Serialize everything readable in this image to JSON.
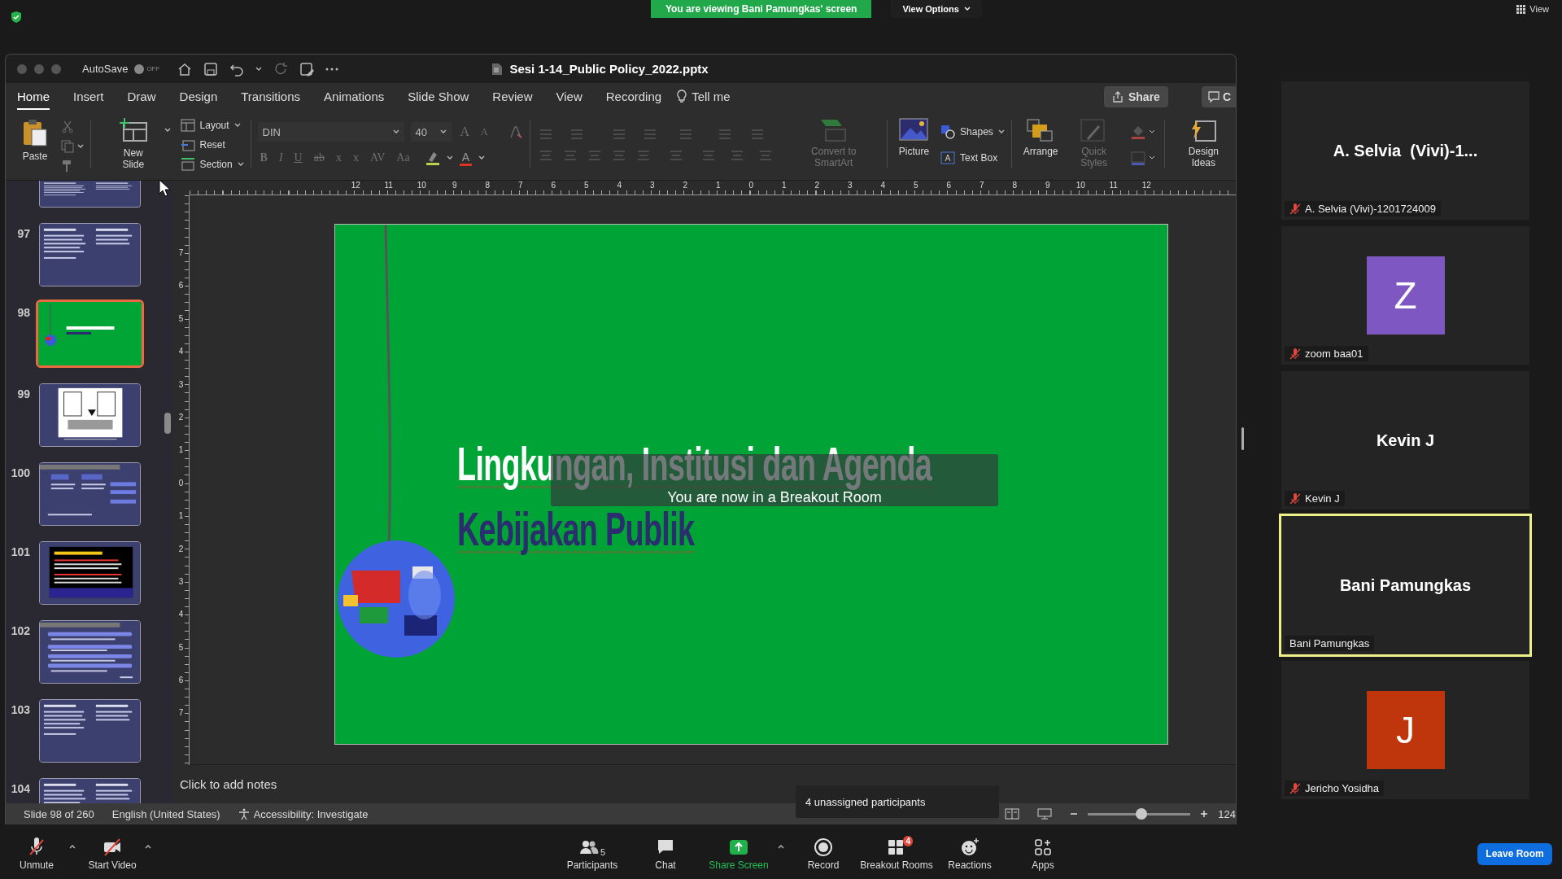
{
  "zoom_top": {
    "banner": "You are viewing Bani Pamungkas' screen",
    "view_options": "View Options",
    "view": "View"
  },
  "ppt": {
    "autosave": {
      "label": "AutoSave",
      "on": false,
      "state": "OFF"
    },
    "title": "Sesi 1-14_Public Policy_2022.pptx",
    "tabs": [
      {
        "label": "Home",
        "selected": true
      },
      {
        "label": "Insert",
        "selected": false
      },
      {
        "label": "Draw",
        "selected": false
      },
      {
        "label": "Design",
        "selected": false
      },
      {
        "label": "Transitions",
        "selected": false
      },
      {
        "label": "Animations",
        "selected": false
      },
      {
        "label": "Slide Show",
        "selected": false
      },
      {
        "label": "Review",
        "selected": false
      },
      {
        "label": "View",
        "selected": false
      },
      {
        "label": "Recording",
        "selected": false
      }
    ],
    "tell_me": "Tell me",
    "share": "Share",
    "comments": "C",
    "ribbon": {
      "paste": {
        "label": "Paste",
        "disabled": false
      },
      "new_slide": {
        "label": "New Slide",
        "disabled": false
      },
      "layout": {
        "label": "Layout",
        "disabled": false
      },
      "reset": {
        "label": "Reset",
        "disabled": false
      },
      "section": {
        "label": "Section",
        "disabled": false
      },
      "font": "DIN",
      "font_size": "40",
      "grow": "A",
      "shrink": "A",
      "format": [
        "B",
        "I",
        "U",
        "ab",
        "x",
        "x",
        "AV",
        "Aa"
      ],
      "font_color": "A",
      "convert": {
        "label": "Convert to SmartArt",
        "disabled": true
      },
      "picture": {
        "label": "Picture",
        "disabled": false
      },
      "shapes": {
        "label": "Shapes",
        "disabled": false
      },
      "text_box": {
        "label": "Text Box",
        "disabled": false
      },
      "arrange": {
        "label": "Arrange",
        "disabled": false
      },
      "quick_styles": {
        "label": "Quick Styles",
        "disabled": true
      },
      "design_ideas": {
        "label": "Design Ideas",
        "disabled": false
      }
    }
  },
  "thumbnails": [
    {
      "kind": "text",
      "partial": true,
      "selected": false
    },
    {
      "number": "97",
      "kind": "text",
      "selected": false
    },
    {
      "number": "98",
      "kind": "title",
      "selected": true
    },
    {
      "number": "99",
      "kind": "cartoon",
      "selected": false
    },
    {
      "number": "100",
      "kind": "diagram",
      "selected": false
    },
    {
      "number": "101",
      "kind": "dark",
      "selected": false
    },
    {
      "number": "102",
      "kind": "list",
      "selected": false
    },
    {
      "number": "103",
      "kind": "text",
      "selected": false
    },
    {
      "number": "104",
      "kind": "text",
      "selected": false
    }
  ],
  "rulers": {
    "horizontal": [
      "12",
      "11",
      "10",
      "9",
      "8",
      "7",
      "6",
      "5",
      "4",
      "3",
      "2",
      "1",
      "0",
      "1",
      "2",
      "3",
      "4",
      "5",
      "6",
      "7",
      "8",
      "9",
      "10",
      "11",
      "12"
    ],
    "vertical": [
      "7",
      "6",
      "5",
      "4",
      "3",
      "2",
      "1",
      "0",
      "1",
      "2",
      "3",
      "4",
      "5",
      "6",
      "7"
    ]
  },
  "slide": {
    "title": "Lingkungan, Institusi dan Agenda",
    "subtitle": "Kebijakan Publik"
  },
  "notes": {
    "placeholder": "Click to add notes"
  },
  "status_bar": {
    "slide": "Slide 98 of 260",
    "language": "English (United States)",
    "accessibility": "Accessibility: Investigate",
    "zoom": {
      "level": 0.52,
      "percent": "124"
    }
  },
  "breakout_notice": "You are now in a Breakout Room",
  "tooltip": "4 unassigned participants",
  "participants": [
    {
      "tile_name": "A. Selvia  (Vivi)-1...",
      "name": "A. Selvia (Vivi)-1201724009",
      "muted": true,
      "active": false
    },
    {
      "avatar": {
        "letter": "Z",
        "color": "#7e57c2"
      },
      "name": "zoom baa01",
      "muted": true,
      "active": false
    },
    {
      "tile_name": "Kevin J",
      "name": "Kevin J",
      "muted": true,
      "active": false
    },
    {
      "tile_name": "Bani Pamungkas",
      "name": "Bani Pamungkas",
      "muted": false,
      "active": true
    },
    {
      "avatar": {
        "letter": "J",
        "color": "#bf360c"
      },
      "name": "Jericho Yosidha",
      "muted": true,
      "active": false
    }
  ],
  "toolbar": {
    "items": [
      {
        "kind": "mic",
        "label": "Unmute",
        "caret": true
      },
      {
        "kind": "video",
        "label": "Start Video",
        "caret": true
      },
      {
        "kind": "participants",
        "label": "Participants",
        "count": "5"
      },
      {
        "kind": "chat",
        "label": "Chat"
      },
      {
        "kind": "share",
        "label": "Share Screen",
        "caret": true
      },
      {
        "kind": "record",
        "label": "Record"
      },
      {
        "kind": "breakout",
        "label": "Breakout Rooms",
        "badge": "4"
      },
      {
        "kind": "reactions",
        "label": "Reactions"
      },
      {
        "kind": "apps",
        "label": "Apps"
      }
    ],
    "leave": "Leave Room"
  }
}
